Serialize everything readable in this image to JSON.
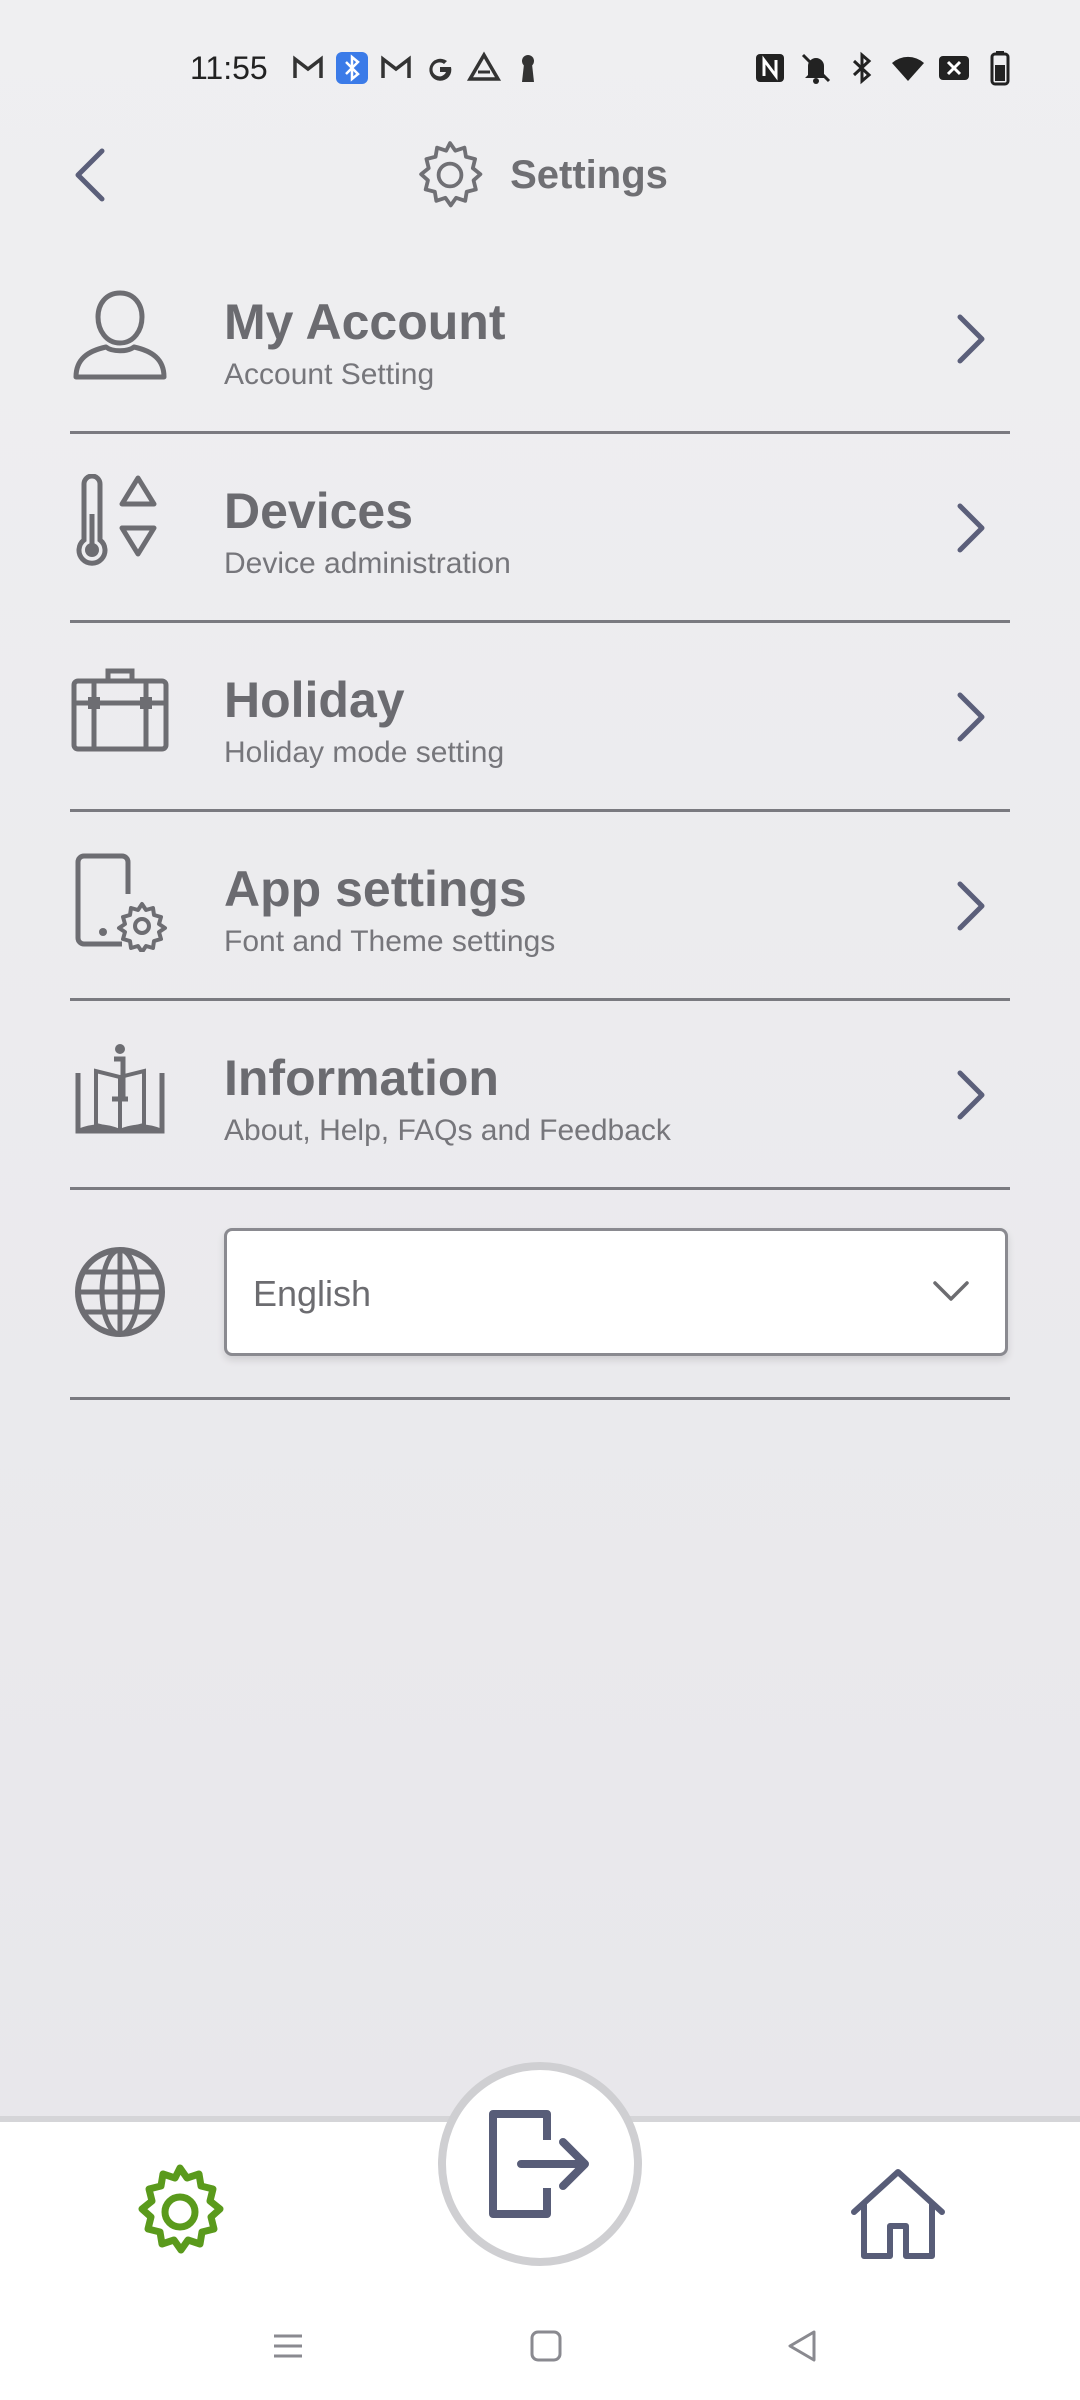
{
  "status_bar": {
    "time": "11:55",
    "left_icons": [
      "gmail-icon",
      "bluetooth-notification-icon",
      "gmail-icon",
      "google-icon",
      "drive-icon",
      "keyhole-icon"
    ],
    "right_icons": [
      "nfc-icon",
      "bell-muted-icon",
      "bluetooth-icon",
      "wifi-icon",
      "no-sim-icon",
      "battery-icon"
    ]
  },
  "header": {
    "title": "Settings",
    "icon": "gear-icon"
  },
  "menu": {
    "items": [
      {
        "title": "My Account",
        "subtitle": "Account Setting",
        "icon": "user-icon"
      },
      {
        "title": "Devices",
        "subtitle": "Device administration",
        "icon": "thermostat-icon"
      },
      {
        "title": "Holiday",
        "subtitle": "Holiday mode setting",
        "icon": "suitcase-icon"
      },
      {
        "title": "App settings",
        "subtitle": "Font and Theme settings",
        "icon": "phone-gear-icon"
      },
      {
        "title": "Information",
        "subtitle": "About, Help, FAQs and Feedback",
        "icon": "info-book-icon"
      }
    ]
  },
  "language": {
    "selected": "English",
    "icon": "globe-icon"
  },
  "bottom_nav": {
    "settings_icon": "gear-icon",
    "logout_icon": "logout-icon",
    "home_icon": "home-icon",
    "active_color": "#5a9a1c"
  },
  "colors": {
    "chevron": "#5b5f7a",
    "icon_gray": "#6d6d72"
  }
}
